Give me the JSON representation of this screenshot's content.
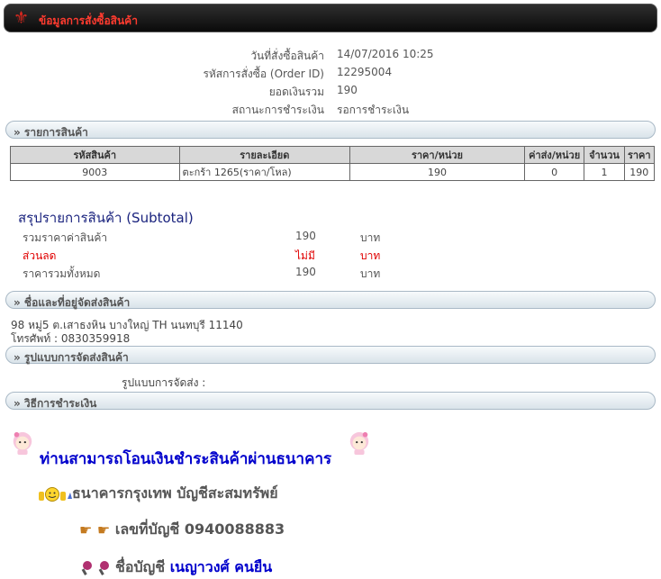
{
  "header": {
    "title": "ข้อมูลการสั่งซื้อสินค้า",
    "icon": "fleur-de-lis-icon"
  },
  "order_info": [
    {
      "label": "วันที่สั่งซื้อสินค้า",
      "value": "14/07/2016 10:25"
    },
    {
      "label": "รหัสการสั่งซื้อ (Order ID)",
      "value": "12295004"
    },
    {
      "label": "ยอดเงินรวม",
      "value": "190"
    },
    {
      "label": "สถานะการชำระเงิน",
      "value": "รอการชำระเงิน"
    }
  ],
  "sections": {
    "items": "» รายการสินค้า",
    "shipping_address": "» ชื่อและที่อยู่จัดส่งสินค้า",
    "shipping_method": "» รูปแบบการจัดส่งสินค้า",
    "payment": "» วิธีการชำระเงิน"
  },
  "table": {
    "headers": [
      "รหัสสินค้า",
      "รายละเอียด",
      "ราคา/หน่วย",
      "ค่าส่ง/หน่วย",
      "จำนวน",
      "ราคา"
    ],
    "rows": [
      [
        "9003",
        "ตะกร้า 1265(ราคา/โหล)",
        "190",
        "0",
        "1",
        "190"
      ]
    ]
  },
  "subtotal": {
    "title": "สรุปรายการสินค้า (Subtotal)",
    "rows": [
      {
        "label": "รวมราคาค่าสินค้า",
        "value": "190",
        "unit": "บาท"
      },
      {
        "label": "ส่วนลด",
        "value": "ไม่มี",
        "unit": "บาท"
      },
      {
        "label": "ราคารวมทั้งหมด",
        "value": "190",
        "unit": "บาท"
      }
    ]
  },
  "address": {
    "line1": "98 หมู่5 ต.เสาธงหิน บางใหญ่ TH นนทบุรี 11140",
    "line2": "โทรศัพท์ : 0830359918"
  },
  "shipping": {
    "label": "รูปแบบการจัดส่ง :"
  },
  "payment_info": {
    "title": "ท่านสามารถโอนเงินชำระสินค้าผ่านธนาคาร",
    "bank": "ธนาคารกรุงเทพ บัญชีสะสมทรัพย์",
    "account_no_label": "เลขที่บัญชี",
    "account_no": "0940088883",
    "account_name_label": "ชื่อบัญชี",
    "account_name": "เนญาวงศ์ คนยืน"
  }
}
